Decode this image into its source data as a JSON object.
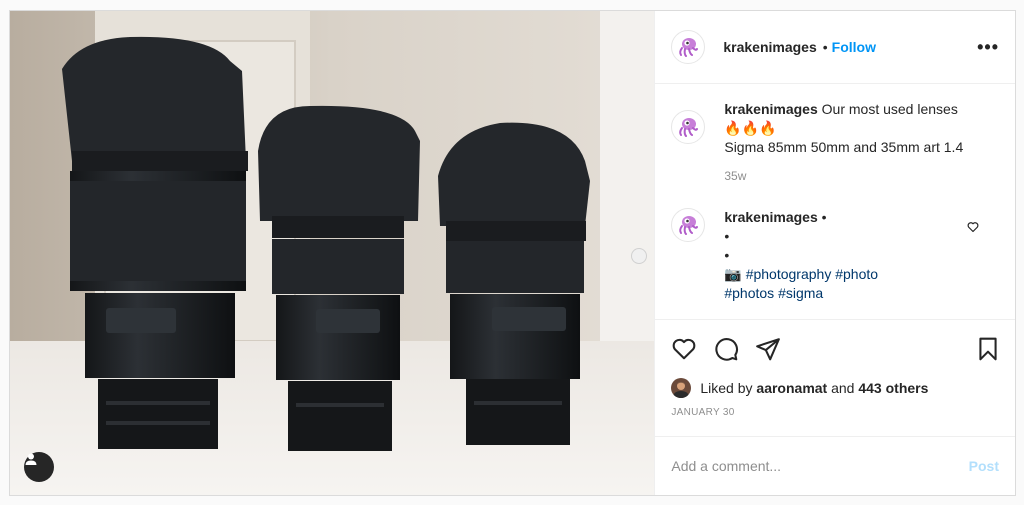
{
  "header": {
    "username": "krakenimages",
    "separator": "•",
    "follow_label": "Follow",
    "more_label": "•••"
  },
  "caption": {
    "username": "krakenimages",
    "text": "Our most used lenses",
    "emoji": "🔥🔥🔥",
    "line2": "Sigma 85mm 50mm and 35mm art 1.4",
    "time": "35w"
  },
  "comment": {
    "username": "krakenimages",
    "separator": "•",
    "dot1": "•",
    "dot2": "•",
    "camera_emoji": "📷",
    "tags_line1": "#photography #photo",
    "tags_line2": "#photos #sigma"
  },
  "likes": {
    "prefix": "Liked by",
    "user": "aaronamat",
    "middle": "and",
    "others": "443 others"
  },
  "date": "JANUARY 30",
  "add_comment": {
    "placeholder": "Add a comment...",
    "post_label": "Post"
  },
  "colors": {
    "link": "#0095f6",
    "post_disabled": "#b2dffc",
    "hashtag": "#00376b"
  },
  "icons": [
    "heart-icon",
    "comment-icon",
    "share-icon",
    "bookmark-icon",
    "user-tag-icon",
    "more-icon"
  ]
}
